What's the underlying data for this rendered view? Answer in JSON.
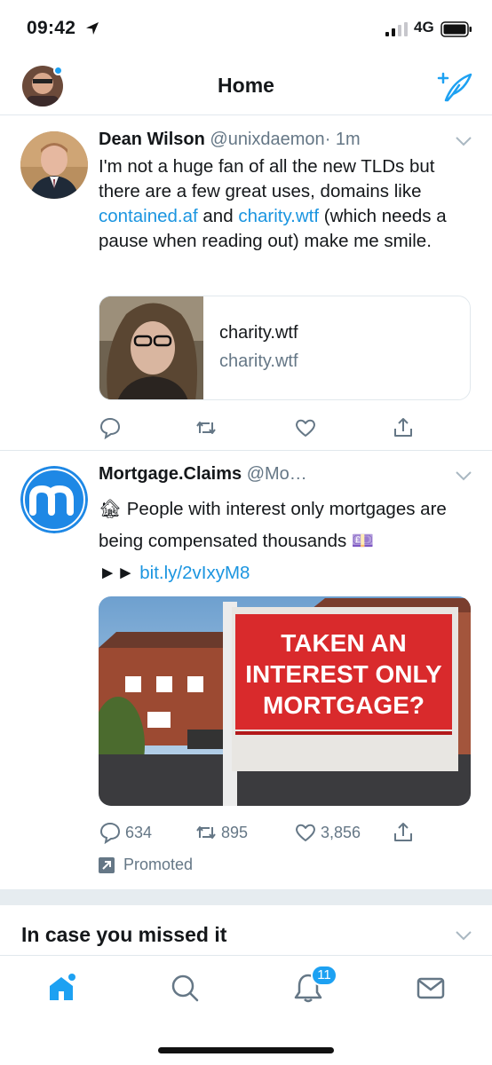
{
  "status_bar": {
    "time": "09:42",
    "network": "4G"
  },
  "header": {
    "title": "Home"
  },
  "tweets": [
    {
      "name": "Dean Wilson",
      "handle": "@unixdaemon",
      "time": "· 1m",
      "text_1": "I'm not a huge fan of all the new TLDs but there are a few great uses, domains like ",
      "link_1": "contained.af",
      "text_2": " and ",
      "link_2": "charity.wtf",
      "text_3": " (which needs a pause when reading out) make me smile.",
      "card": {
        "title": "charity.wtf",
        "url": "charity.wtf"
      }
    },
    {
      "name": "Mortgage.Claims",
      "handle": "@Mo…",
      "text_1": "🏚 People with interest only mortgages are being compensated thousands 💷",
      "text_2": "►► ",
      "link_1": "bit.ly/2vIxyM8",
      "media_sign": [
        "TAKEN AN",
        "INTEREST ONLY",
        "MORTGAGE?"
      ],
      "replies": "634",
      "retweets": "895",
      "likes": "3,856",
      "promoted_label": "Promoted"
    }
  ],
  "missed_section": {
    "title": "In case you missed it"
  },
  "tabbar": {
    "notifications_badge": "11"
  },
  "colors": {
    "accent": "#1da1f2",
    "link": "#1b95e0",
    "muted": "#657786",
    "sign_red": "#d92a2c"
  }
}
